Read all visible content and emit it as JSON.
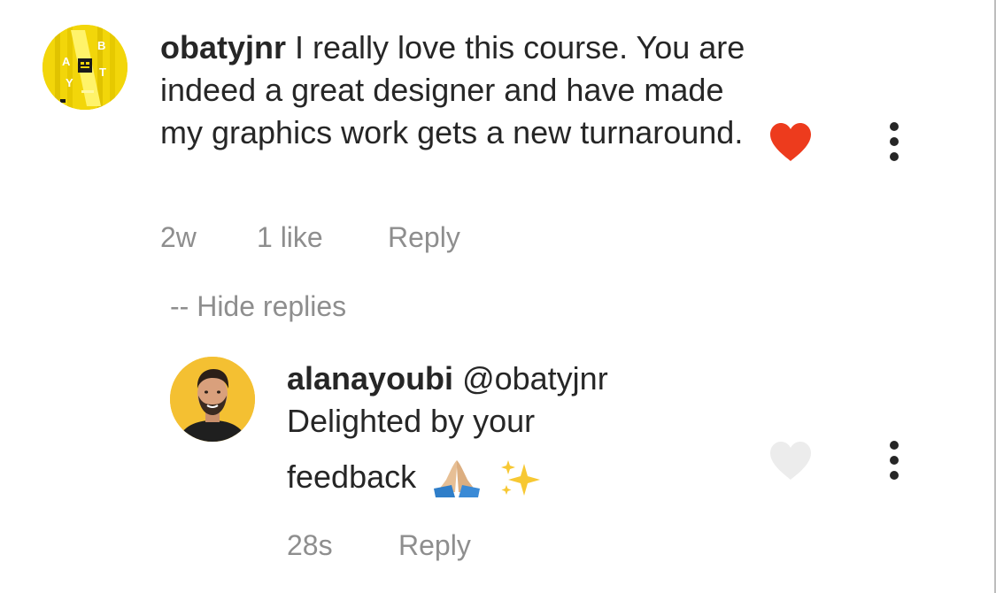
{
  "comment": {
    "username": "obatyjnr",
    "text": " I really love this course. You are indeed a great designer and have made my graphics work gets a new turnaround.",
    "time": "2w",
    "likes": "1 like",
    "reply_label": "Reply",
    "liked": true,
    "avatar_letters": [
      "A",
      "B",
      "T",
      "Y"
    ]
  },
  "hide_replies_label": "-- Hide replies",
  "reply": {
    "username": "alanayoubi",
    "mention": " @obatyjnr",
    "text_line2": "Delighted by your",
    "text_line3": "feedback",
    "time": "28s",
    "reply_label": "Reply",
    "liked": false
  },
  "colors": {
    "heart_liked": "#ed3b1d",
    "heart_unliked": "#ececec",
    "meta_text": "#8e8e8e",
    "main_text": "#262626",
    "avatar_main_bg": "#f2d60a",
    "avatar_reply_bg": "#f4c032"
  },
  "icons": {
    "like": "heart-icon",
    "more": "more-vertical-icon",
    "emoji_1": "folded-hands-emoji",
    "emoji_2": "sparkles-emoji"
  }
}
